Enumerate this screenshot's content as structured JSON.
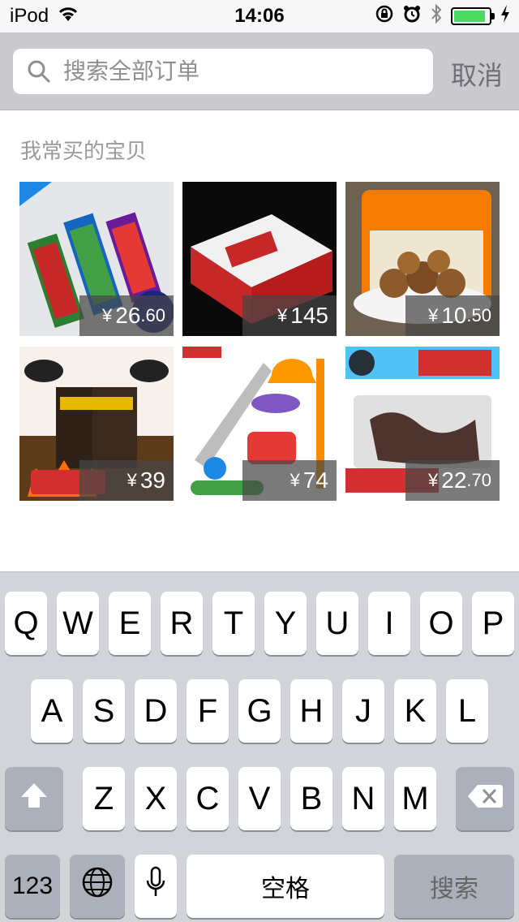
{
  "status_bar": {
    "carrier": "iPod",
    "time": "14:06",
    "battery_level": 0.9
  },
  "search": {
    "placeholder": "搜索全部订单",
    "cancel_label": "取消"
  },
  "section": {
    "title": "我常买的宝贝"
  },
  "products": [
    {
      "currency": "¥",
      "int": "26",
      "dec": ".60"
    },
    {
      "currency": "¥",
      "int": "145",
      "dec": ""
    },
    {
      "currency": "¥",
      "int": "10",
      "dec": ".50"
    },
    {
      "currency": "¥",
      "int": "39",
      "dec": ""
    },
    {
      "currency": "¥",
      "int": "74",
      "dec": ""
    },
    {
      "currency": "¥",
      "int": "22",
      "dec": ".70"
    }
  ],
  "keyboard": {
    "row1": [
      "Q",
      "W",
      "E",
      "R",
      "T",
      "Y",
      "U",
      "I",
      "O",
      "P"
    ],
    "row2": [
      "A",
      "S",
      "D",
      "F",
      "G",
      "H",
      "J",
      "K",
      "L"
    ],
    "row3": [
      "Z",
      "X",
      "C",
      "V",
      "B",
      "N",
      "M"
    ],
    "numbers_label": "123",
    "space_label": "空格",
    "search_label": "搜索"
  },
  "colors": {
    "search_header_bg": "#c9c9ce",
    "keyboard_bg": "#d1d4d9",
    "battery_green": "#4cd964"
  }
}
